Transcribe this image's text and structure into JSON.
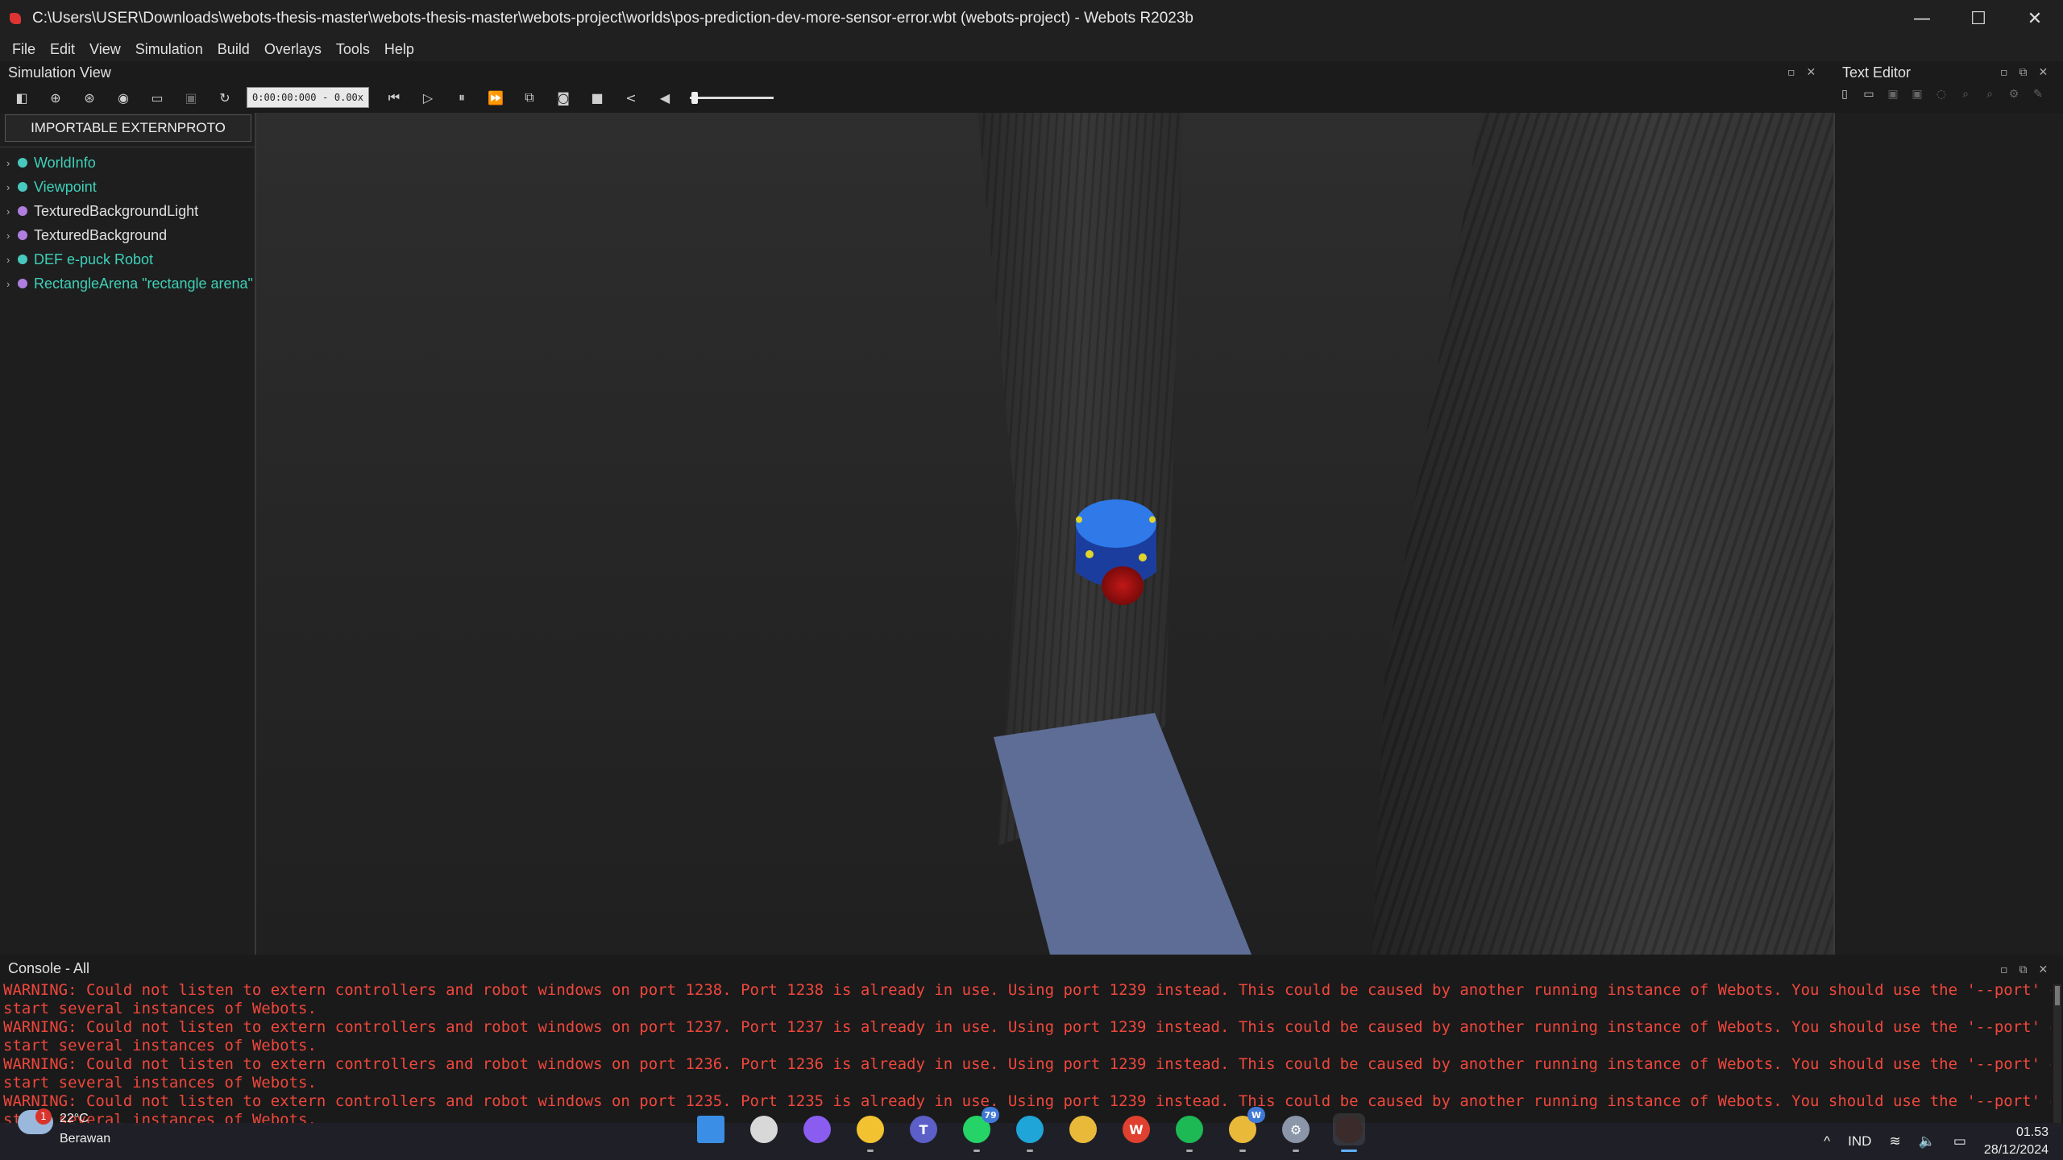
{
  "window": {
    "title": "C:\\Users\\USER\\Downloads\\webots-thesis-master\\webots-thesis-master\\webots-project\\worlds\\pos-prediction-dev-more-sensor-error.wbt (webots-project) - Webots R2023b",
    "minimize": "—",
    "maximize": "☐",
    "close": "✕"
  },
  "menu": [
    "File",
    "Edit",
    "View",
    "Simulation",
    "Build",
    "Overlays",
    "Tools",
    "Help"
  ],
  "simulation_view": {
    "title": "Simulation View",
    "time": "0:00:00:000",
    "time_sep": "-",
    "speed": "0.00x"
  },
  "scene_tree": {
    "extern_button": "IMPORTABLE EXTERNPROTO",
    "items": [
      {
        "label": "WorldInfo",
        "color": "#3fd0b8",
        "dot": "#48c9c0"
      },
      {
        "label": "Viewpoint",
        "color": "#3fd0b8",
        "dot": "#48c9c0"
      },
      {
        "label": "TexturedBackgroundLight",
        "color": "#e0e0e0",
        "dot": "#b07ee0"
      },
      {
        "label": "TexturedBackground",
        "color": "#e0e0e0",
        "dot": "#b07ee0"
      },
      {
        "label": "DEF e-puck Robot",
        "color": "#3fd0b8",
        "dot": "#48c9c0"
      },
      {
        "label": "RectangleArena \"rectangle arena\"",
        "color": "#3fd0b8",
        "dot": "#b07ee0"
      }
    ]
  },
  "text_editor": {
    "title": "Text Editor"
  },
  "console": {
    "title": "Console - All",
    "lines": [
      "WARNING: Could not listen to extern controllers and robot windows on port 1238. Port 1238 is already in use. Using port 1239 instead. This could be caused by another running instance of Webots. You should use the '--port' option to",
      "start several instances of Webots.",
      "WARNING: Could not listen to extern controllers and robot windows on port 1237. Port 1237 is already in use. Using port 1239 instead. This could be caused by another running instance of Webots. You should use the '--port' option to",
      "start several instances of Webots.",
      "WARNING: Could not listen to extern controllers and robot windows on port 1236. Port 1236 is already in use. Using port 1239 instead. This could be caused by another running instance of Webots. You should use the '--port' option to",
      "start several instances of Webots.",
      "WARNING: Could not listen to extern controllers and robot windows on port 1235. Port 1235 is already in use. Using port 1239 instead. This could be caused by another running instance of Webots. You should use the '--port' option to",
      "start several instances of Webots."
    ]
  },
  "taskbar": {
    "weather": {
      "badge": "1",
      "temp": "22°C",
      "condition": "Berawan"
    },
    "apps": [
      {
        "name": "start",
        "color": "#3a8ee6",
        "glyph": "",
        "badge": ""
      },
      {
        "name": "task-view",
        "color": "#d8d8d8",
        "glyph": "",
        "badge": ""
      },
      {
        "name": "copilot",
        "color": "#8a5cf0",
        "glyph": "",
        "badge": ""
      },
      {
        "name": "file-explorer",
        "color": "#f2c230",
        "glyph": "",
        "badge": ""
      },
      {
        "name": "teams",
        "color": "#5b5fc7",
        "glyph": "T",
        "badge": ""
      },
      {
        "name": "whatsapp",
        "color": "#25d366",
        "glyph": "",
        "badge": "79"
      },
      {
        "name": "edge",
        "color": "#1fa5d8",
        "glyph": "",
        "badge": ""
      },
      {
        "name": "chrome",
        "color": "#e9b93a",
        "glyph": "",
        "badge": ""
      },
      {
        "name": "wps",
        "color": "#e0402f",
        "glyph": "W",
        "badge": ""
      },
      {
        "name": "spotify",
        "color": "#1db954",
        "glyph": "",
        "badge": ""
      },
      {
        "name": "chrome-profile",
        "color": "#e9b93a",
        "glyph": "",
        "badge": "W"
      },
      {
        "name": "settings",
        "color": "#8b96a8",
        "glyph": "⚙",
        "badge": ""
      },
      {
        "name": "webots",
        "color": "#3b2b2b",
        "glyph": "",
        "badge": ""
      }
    ],
    "tray": {
      "chevron": "^",
      "language": "IND",
      "wifi": "≋",
      "volume": "🔈",
      "battery": "▭"
    },
    "clock": {
      "time": "01.53",
      "date": "28/12/2024"
    }
  }
}
